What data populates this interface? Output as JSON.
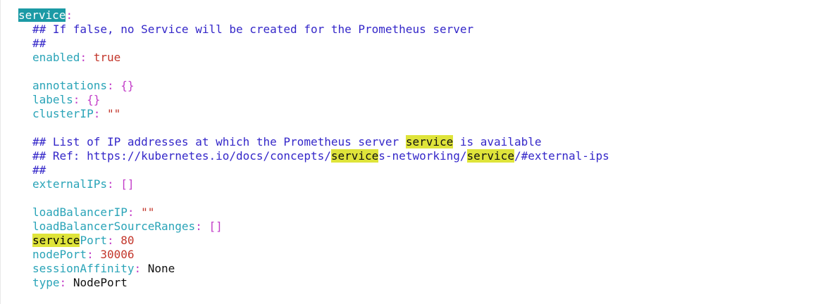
{
  "lines": {
    "l1": {
      "key_hl": "service",
      "colon": ":"
    },
    "l2": {
      "text": "## If false, no Service will be created for the Prometheus server"
    },
    "l3": {
      "text": "##"
    },
    "l4": {
      "key": "enabled",
      "colon": ":",
      "value": "true"
    },
    "l6": {
      "key": "annotations",
      "colon": ":",
      "value": "{}"
    },
    "l7": {
      "key": "labels",
      "colon": ":",
      "value": "{}"
    },
    "l8": {
      "key": "clusterIP",
      "colon": ":",
      "value": "\"\""
    },
    "l10": {
      "pre": "## List of IP addresses at which the Prometheus server ",
      "hl": "service",
      "post": " is available"
    },
    "l11": {
      "pre": "## Ref: https://kubernetes.io/docs/concepts/",
      "hl1": "service",
      "mid": "s-networking/",
      "hl2": "service",
      "post": "/#external-ips"
    },
    "l12": {
      "text": "##"
    },
    "l13": {
      "key": "externalIPs",
      "colon": ":",
      "value": "[]"
    },
    "l15": {
      "key": "loadBalancerIP",
      "colon": ":",
      "value": "\"\""
    },
    "l16": {
      "key": "loadBalancerSourceRanges",
      "colon": ":",
      "value": "[]"
    },
    "l17": {
      "key_hl": "service",
      "key_rest": "Port",
      "colon": ":",
      "value": "80"
    },
    "l18": {
      "key": "nodePort",
      "colon": ":",
      "value": "30006"
    },
    "l19": {
      "key": "sessionAffinity",
      "colon": ":",
      "value": "None"
    },
    "l20": {
      "key": "type",
      "colon": ":",
      "value": "NodePort"
    }
  },
  "colors": {
    "key": "#2aa4b8",
    "comment": "#3427c9",
    "punctuation": "#c23dc8",
    "literal": "#c3362b",
    "search_highlight": "#dfe43a",
    "current_match": "#1b9aa5"
  }
}
